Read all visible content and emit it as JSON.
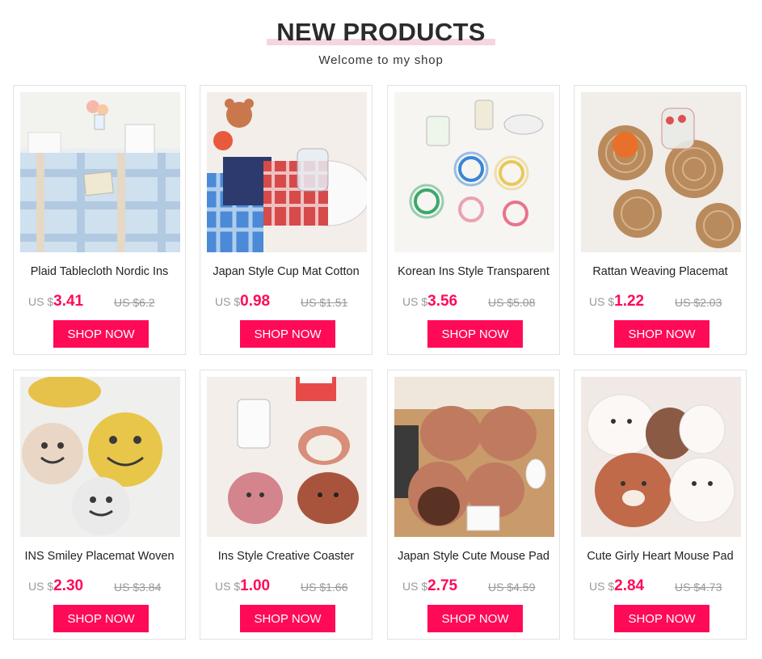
{
  "header": {
    "title": "NEW PRODUCTS",
    "subtitle": "Welcome to my shop"
  },
  "colors": {
    "accent": "#ff0a57",
    "title_highlight": "#f6d5de"
  },
  "button_label": "SHOP NOW",
  "products": [
    {
      "name": "Plaid Tablecloth Nordic Ins",
      "currency": "US $",
      "price": "3.41",
      "old_price": "US $6.2"
    },
    {
      "name": "Japan Style Cup Mat Cotton",
      "currency": "US $",
      "price": "0.98",
      "old_price": "US $1.51"
    },
    {
      "name": "Korean Ins Style Transparent",
      "currency": "US $",
      "price": "3.56",
      "old_price": "US $5.08"
    },
    {
      "name": "Rattan Weaving Placemat",
      "currency": "US $",
      "price": "1.22",
      "old_price": "US $2.03"
    },
    {
      "name": "INS Smiley Placemat Woven",
      "currency": "US $",
      "price": "2.30",
      "old_price": "US $3.84"
    },
    {
      "name": "Ins Style Creative Coaster",
      "currency": "US $",
      "price": "1.00",
      "old_price": "US $1.66"
    },
    {
      "name": "Japan Style Cute Mouse Pad",
      "currency": "US $",
      "price": "2.75",
      "old_price": "US $4.59"
    },
    {
      "name": "Cute Girly Heart Mouse Pad",
      "currency": "US $",
      "price": "2.84",
      "old_price": "US $4.73"
    }
  ]
}
